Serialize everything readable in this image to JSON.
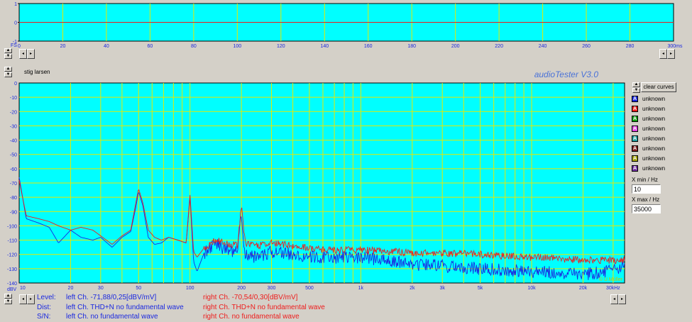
{
  "oscilloscope": {
    "y_tick_labels": [
      "1",
      "0",
      "-1"
    ],
    "x_tick_labels": [
      "0",
      "20",
      "40",
      "60",
      "80",
      "100",
      "120",
      "140",
      "160",
      "180",
      "200",
      "220",
      "240",
      "260",
      "280"
    ],
    "x_last_label": "300ms",
    "fs_label": "FS"
  },
  "header": {
    "user_name": "stig larsen",
    "brand": "audioTester  V3.0"
  },
  "spectrum": {
    "y_tick_labels": [
      "0",
      "-10",
      "-20",
      "-30",
      "-40",
      "-50",
      "-60",
      "-70",
      "-80",
      "-90",
      "-100",
      "-110",
      "-120",
      "-130",
      "-140"
    ],
    "unit_label": "dBV",
    "x_tick_labels": [
      "10",
      "20",
      "30",
      "50",
      "100",
      "200",
      "300",
      "500",
      "1k",
      "2k",
      "3k",
      "5k",
      "10k",
      "20k",
      "30kHz"
    ],
    "copyright": "© U.Müller"
  },
  "colors": {
    "plot_bg": "#00ffff",
    "grid": "#e8e800",
    "left_channel": "#1a28e0",
    "right_channel": "#ee1c1c",
    "brand": "#4a72d8"
  },
  "side_panel": {
    "clear_curves_label": "clear curves",
    "curves": [
      {
        "letter": "A",
        "color": "#1a28e0",
        "label": "unknown"
      },
      {
        "letter": "A",
        "color": "#ee1c1c",
        "label": "unknown"
      },
      {
        "letter": "A",
        "color": "#10a010",
        "label": "unknown"
      },
      {
        "letter": "A",
        "color": "#e040e0",
        "label": "unknown"
      },
      {
        "letter": "A",
        "color": "#20a0a0",
        "label": "unknown"
      },
      {
        "letter": "A",
        "color": "#802020",
        "label": "unknown"
      },
      {
        "letter": "A",
        "color": "#a0a000",
        "label": "unknown"
      },
      {
        "letter": "A",
        "color": "#7030a0",
        "label": "unknown"
      }
    ],
    "xmin_label": "X min / Hz",
    "xmin_value": "10",
    "xmax_label": "X max / Hz",
    "xmax_value": "35000"
  },
  "status": {
    "level_label": "Level:",
    "level_left": "left Ch. -71,88/0,25[dBV/mV]",
    "level_right": "right Ch. -70,54/0,30[dBV/mV]",
    "dist_label": "Dist:",
    "dist_left": "left Ch. THD+N  no fundamental wave",
    "dist_right": "right Ch. THD+N  no fundamental wave",
    "sn_label": "S/N:",
    "sn_left": "left Ch.  no fundamental wave",
    "sn_right": "right Ch.  no fundamental wave"
  },
  "chart_data": [
    {
      "type": "line",
      "x": [
        0,
        20,
        40,
        60,
        80,
        100,
        120,
        140,
        160,
        180,
        200,
        220,
        240,
        260,
        280,
        300
      ],
      "xlim": [
        0,
        300
      ],
      "ylim": [
        -1,
        1
      ],
      "series": [
        {
          "values": [
            0,
            0,
            0,
            0,
            0,
            0,
            0,
            0,
            0,
            0,
            0,
            0,
            0,
            0,
            0,
            0
          ],
          "color": "#1a28e0"
        },
        {
          "values": [
            0,
            0,
            0,
            0,
            0,
            0,
            0,
            0,
            0,
            0,
            0,
            0,
            0,
            0,
            0,
            0
          ],
          "color": "#ee1c1c"
        }
      ],
      "grid": true
    },
    {
      "type": "line",
      "x_scale": "log",
      "xlim": [
        10,
        35000
      ],
      "ylim": [
        -140,
        0
      ],
      "x": [
        10,
        11,
        13,
        15,
        17,
        20,
        23,
        27,
        30,
        35,
        40,
        45,
        48,
        50,
        53,
        57,
        62,
        68,
        75,
        85,
        95,
        100,
        105,
        110,
        120,
        140,
        160,
        190,
        200,
        210,
        250,
        300,
        400,
        500,
        700,
        1000,
        1500,
        2000,
        3000,
        5000,
        7000,
        10000,
        15000,
        20000,
        30000,
        35000
      ],
      "series": [
        {
          "values": [
            -66,
            -95,
            -98,
            -101,
            -112,
            -103,
            -108,
            -110,
            -108,
            -115,
            -108,
            -104,
            -88,
            -76,
            -86,
            -108,
            -113,
            -112,
            -108,
            -110,
            -112,
            -80,
            -125,
            -132,
            -120,
            -112,
            -117,
            -118,
            -90,
            -120,
            -122,
            -118,
            -120,
            -122,
            -122,
            -122,
            -125,
            -127,
            -128,
            -130,
            -131,
            -132,
            -133,
            -134,
            -131,
            -128
          ],
          "color": "#1a28e0"
        },
        {
          "values": [
            -68,
            -93,
            -95,
            -97,
            -100,
            -103,
            -101,
            -103,
            -107,
            -113,
            -107,
            -103,
            -85,
            -74,
            -84,
            -103,
            -108,
            -110,
            -108,
            -110,
            -112,
            -78,
            -118,
            -122,
            -116,
            -110,
            -112,
            -114,
            -86,
            -112,
            -114,
            -112,
            -114,
            -116,
            -117,
            -117,
            -118,
            -119,
            -119,
            -120,
            -121,
            -122,
            -123,
            -124,
            -124,
            -124
          ],
          "color": "#ee1c1c"
        }
      ],
      "grid": true
    }
  ]
}
